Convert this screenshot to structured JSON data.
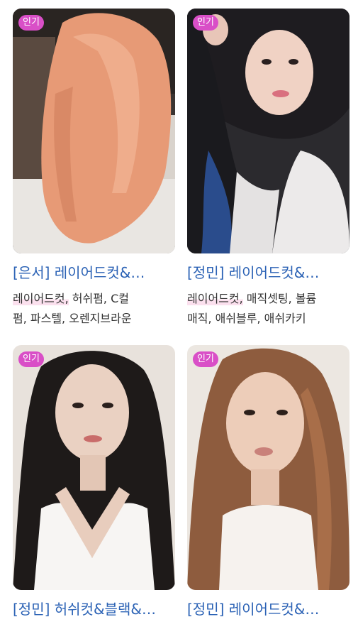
{
  "cards": [
    {
      "badge": "인기",
      "title": "[은서] 레이어드컷&…",
      "tag_highlight": "레이어드컷,",
      "tag_rest_line1": " 허쉬펌, C컬",
      "tag_line2": "펌, 파스텔, 오렌지브라운",
      "image_desc": "peach-orange-layered-hair-photo"
    },
    {
      "badge": "인기",
      "title": "[정민] 레이어드컷&…",
      "tag_highlight": "레이어드컷,",
      "tag_rest_line1": " 매직셋팅, 볼륨",
      "tag_line2": "매직, 애쉬블루, 애쉬카키",
      "image_desc": "dark-hair-blue-ends-selfie-photo"
    },
    {
      "badge": "인기",
      "title": "[정민] 허쉬컷&블랙&…",
      "image_desc": "long-black-wavy-hair-portrait"
    },
    {
      "badge": "인기",
      "title": "[정민] 레이어드컷&…",
      "image_desc": "long-brown-layered-hair-portrait"
    }
  ],
  "colors": {
    "badge": "#d94fc7",
    "title": "#2b62b5",
    "tag_text": "#333333",
    "tag_highlight": "#fbe0ee"
  }
}
